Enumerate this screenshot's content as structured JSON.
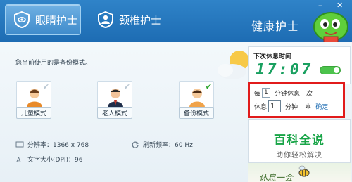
{
  "header": {
    "tabs": [
      {
        "label": "眼睛护士",
        "icon": "shield-icon",
        "active": true
      },
      {
        "label": "颈椎护士",
        "icon": "person-shield-icon",
        "active": false
      }
    ],
    "brand": "健康护士",
    "window_buttons": [
      "minimize-icon",
      "close-icon"
    ]
  },
  "main": {
    "hint": "您当前使用的是备份模式。",
    "modes": [
      {
        "label": "儿童模式",
        "icon": "child-avatar-icon",
        "checked": false
      },
      {
        "label": "老人模式",
        "icon": "elder-avatar-icon",
        "checked": false
      },
      {
        "label": "备份模式",
        "icon": "backup-avatar-icon",
        "checked": true
      }
    ],
    "resolution": "分辨率：1366 x 768",
    "refresh_rate": "刷新频率：60 Hz",
    "text_size": "文字大小(DPI)：96"
  },
  "panel": {
    "title": "下次休息时间",
    "time": "17:07",
    "toggle_on": true
  },
  "settings": {
    "every_prefix": "每",
    "every_value": "1",
    "every_suffix": "分钟休息一次",
    "rest_prefix": "休息",
    "rest_value": "1",
    "rest_suffix": "分钟",
    "confirm": "确定"
  },
  "ad": {
    "title": "百科全说",
    "subtitle": "助你轻松解决",
    "bottom_text": "休息一会"
  },
  "colors": {
    "header": "#2f83c8",
    "accent_green": "#1aa060",
    "highlight_border": "#e11b1b"
  }
}
